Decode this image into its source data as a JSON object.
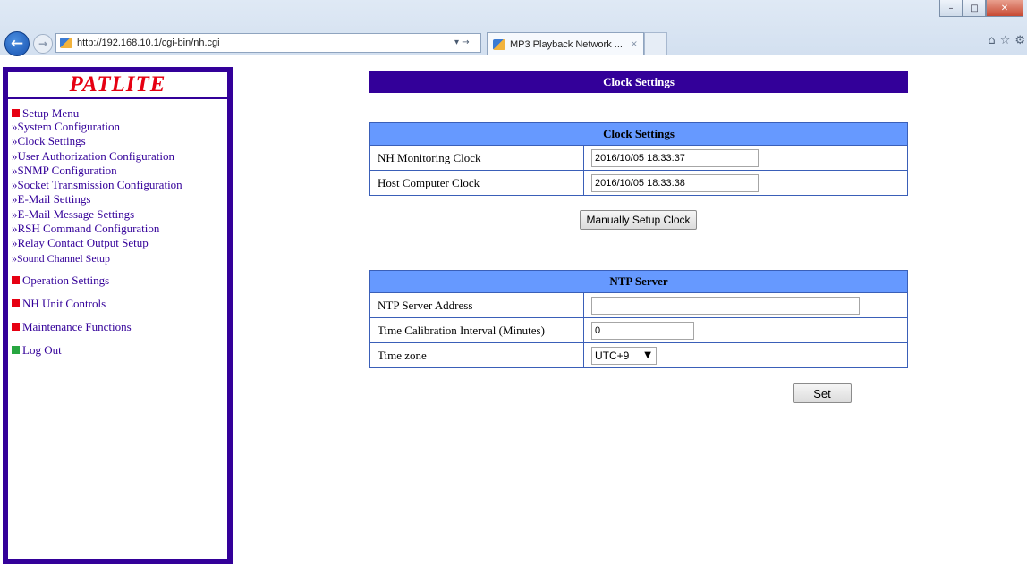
{
  "browser": {
    "url": "http://192.168.10.1/cgi-bin/nh.cgi",
    "tab_title": "MP3 Playback Network ...",
    "tab_close": "×",
    "addr_controls": "▾ →",
    "back_glyph": "←",
    "forward_glyph": "→",
    "window_controls": {
      "minimize": "–",
      "maximize": "□",
      "close": "✕"
    },
    "tool_icons": {
      "home": "⌂",
      "favorites": "☆",
      "settings": "⚙"
    }
  },
  "sidebar": {
    "logo": "PATLITE",
    "setup_menu": {
      "label": "Setup Menu",
      "items": [
        "»System Configuration",
        "»Clock Settings",
        "»User Authorization Configuration",
        "»SNMP Configuration",
        "»Socket Transmission Configuration",
        "»E-Mail Settings",
        "»E-Mail Message Settings",
        "»RSH Command Configuration",
        "»Relay Contact Output Setup",
        "»Sound Channel Setup"
      ]
    },
    "operation_settings": "Operation Settings",
    "nh_unit_controls": "NH Unit Controls",
    "maintenance_functions": "Maintenance Functions",
    "log_out": "Log Out",
    "colors": {
      "menu_red": "#e60012",
      "logout_green": "#27a640",
      "frame": "#330099"
    }
  },
  "main": {
    "page_title": "Clock Settings",
    "clock_table": {
      "header": "Clock Settings",
      "nh_label": "NH Monitoring Clock",
      "nh_value": "2016/10/05 18:33:37",
      "host_label": "Host Computer Clock",
      "host_value": "2016/10/05 18:33:38"
    },
    "manual_button": "Manually Setup Clock",
    "ntp_table": {
      "header": "NTP Server",
      "address_label": "NTP Server Address",
      "address_value": "",
      "interval_label": "Time Calibration Interval (Minutes)",
      "interval_value": "0",
      "timezone_label": "Time zone",
      "timezone_value": "UTC+9"
    },
    "set_button": "Set",
    "colors": {
      "title_bg": "#330099",
      "header_bg": "#6699ff"
    }
  }
}
